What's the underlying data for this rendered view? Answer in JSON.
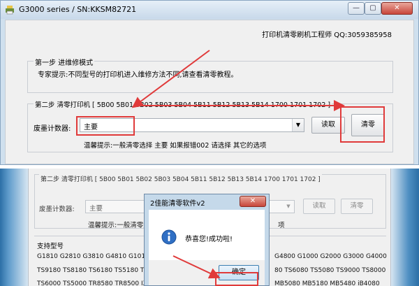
{
  "window": {
    "title": "G3000 series / SN:KKSM82721",
    "minimize": "—",
    "maximize": "▢",
    "close": "✕"
  },
  "engineer": "打印机清零刷机工程师 QQ:3059385958",
  "step1": {
    "title": "第一步 进维修模式",
    "hint": "专家提示:不同型号的打印机进入维修方法不同,请查看清零教程。"
  },
  "step2": {
    "title": "第二步 清零打印机 [ 5B00 5B01 5B02 5B03 5B04 5B11 5B12 5B13 5B14 1700 1701 1702   ]",
    "counter_label": "废墨计数器:",
    "counter_value": "主要",
    "read_button": "读取",
    "clear_button": "清零",
    "tip": "温馨提示:一般清零选择 主要   如果报错002 请选择 其它的选项"
  },
  "bottom": {
    "step2_title": "第二步 清零打印机 [ 5B00 5B01 5B02 5B03 5B04 5B11 5B12 5B13 5B14 1700 1701 1702 ]",
    "counter_label": "废墨计数器:",
    "counter_value": "主要",
    "read_button": "读取",
    "clear_button": "清零",
    "tip_left": "温馨提示:一般清零选",
    "tip_right": "项",
    "models_title": "支持型号",
    "models_line1_left": "G1810 G2810 G3810 G4810 G1010 G",
    "models_line1_right": "G4800 G1000 G2000 G3000 G4000",
    "models_line2_left": "TS9180 TS8180 TS6180 TS5180 TS",
    "models_line2_right": "80 TS6080 TS5080 TS9000 TS8000",
    "models_line3_left": "TS6000 TS5000 TR8580 TR8500 IX6",
    "models_line3_right": "MB5080 MB5180 MB5480 iB4080"
  },
  "dialog": {
    "title": "2佳能清零软件v2",
    "close": "✕",
    "message": "恭喜您!成功啦!",
    "ok_button": "确定"
  },
  "colors": {
    "annotation_red": "#e03a3a",
    "titlebar": "#c8d9ea",
    "close_red": "#c8453a"
  }
}
